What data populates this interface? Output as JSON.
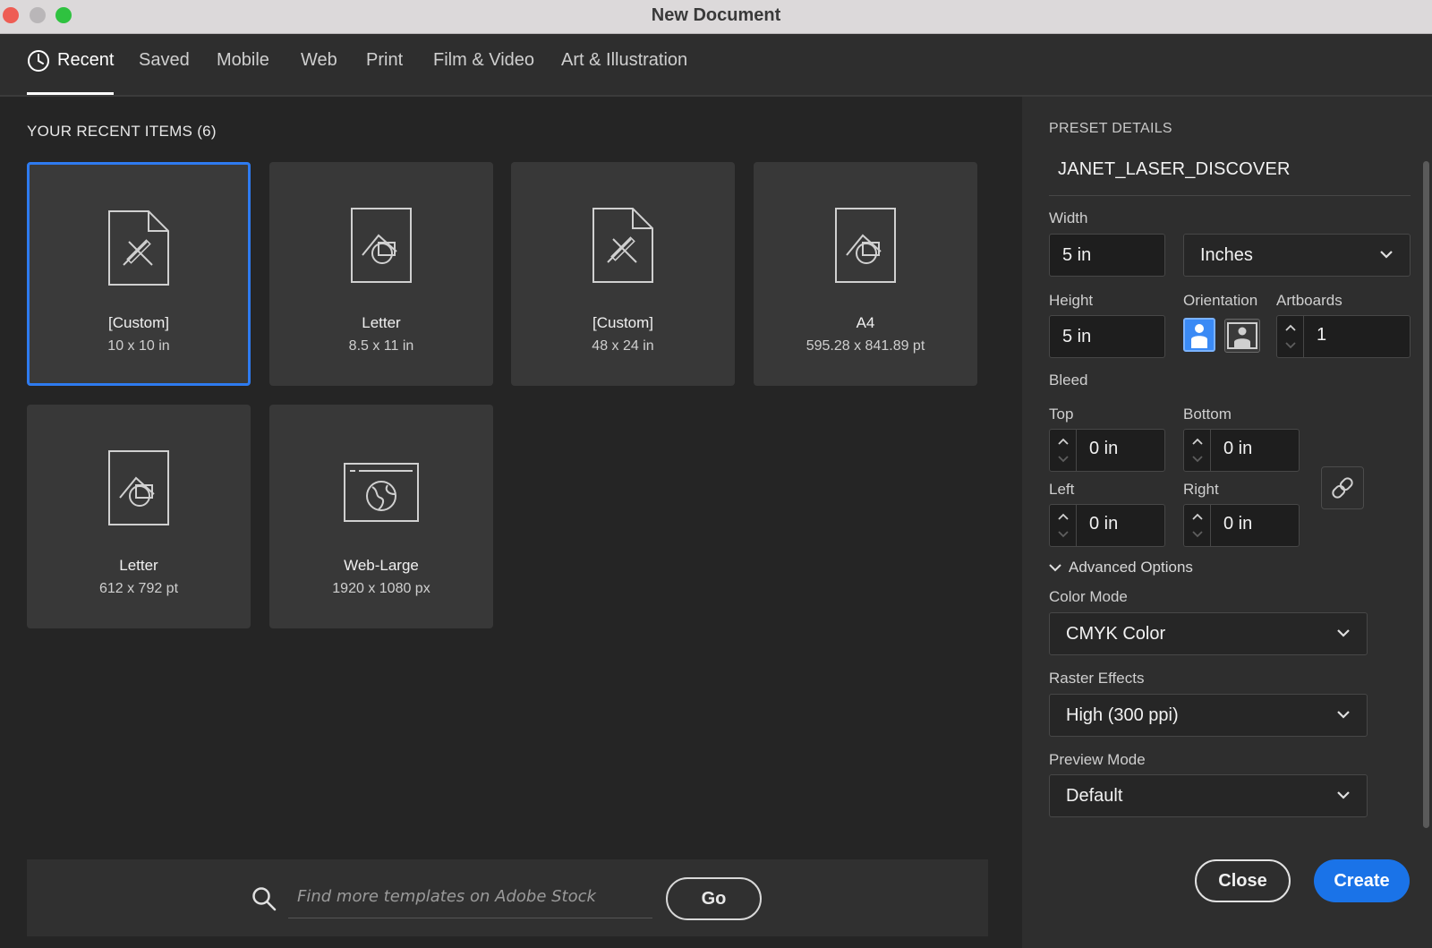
{
  "window": {
    "title": "New Document"
  },
  "tabs": [
    {
      "label": "Recent",
      "active": true
    },
    {
      "label": "Saved"
    },
    {
      "label": "Mobile"
    },
    {
      "label": "Web"
    },
    {
      "label": "Print"
    },
    {
      "label": "Film & Video"
    },
    {
      "label": "Art & Illustration"
    }
  ],
  "recent": {
    "title": "YOUR RECENT ITEMS  (6)",
    "items": [
      {
        "name": "[Custom]",
        "dims": "10 x 10 in",
        "icon": "custom-doc-icon",
        "selected": true
      },
      {
        "name": "Letter",
        "dims": "8.5 x 11 in",
        "icon": "print-doc-icon"
      },
      {
        "name": "[Custom]",
        "dims": "48 x 24 in",
        "icon": "custom-doc-icon"
      },
      {
        "name": "A4",
        "dims": "595.28 x 841.89 pt",
        "icon": "print-doc-icon"
      },
      {
        "name": "Letter",
        "dims": "612 x 792 pt",
        "icon": "print-doc-icon"
      },
      {
        "name": "Web-Large",
        "dims": "1920 x 1080 px",
        "icon": "web-doc-icon"
      }
    ]
  },
  "search": {
    "placeholder": "Find more templates on Adobe Stock",
    "go_label": "Go"
  },
  "preset": {
    "heading": "PRESET DETAILS",
    "name": "JANET_LASER_DISCOVER",
    "width_label": "Width",
    "width_value": "5 in",
    "units": "Inches",
    "height_label": "Height",
    "height_value": "5 in",
    "orientation_label": "Orientation",
    "artboards_label": "Artboards",
    "artboards_value": "1",
    "bleed_label": "Bleed",
    "bleed": {
      "top_label": "Top",
      "top": "0 in",
      "bottom_label": "Bottom",
      "bottom": "0 in",
      "left_label": "Left",
      "left": "0 in",
      "right_label": "Right",
      "right": "0 in"
    },
    "advanced_label": "Advanced Options",
    "color_mode_label": "Color Mode",
    "color_mode": "CMYK Color",
    "raster_label": "Raster Effects",
    "raster": "High (300 ppi)",
    "preview_label": "Preview Mode",
    "preview": "Default"
  },
  "actions": {
    "close_label": "Close",
    "create_label": "Create"
  },
  "colors": {
    "accent": "#1a73e8",
    "selection": "#2e7bf0"
  }
}
